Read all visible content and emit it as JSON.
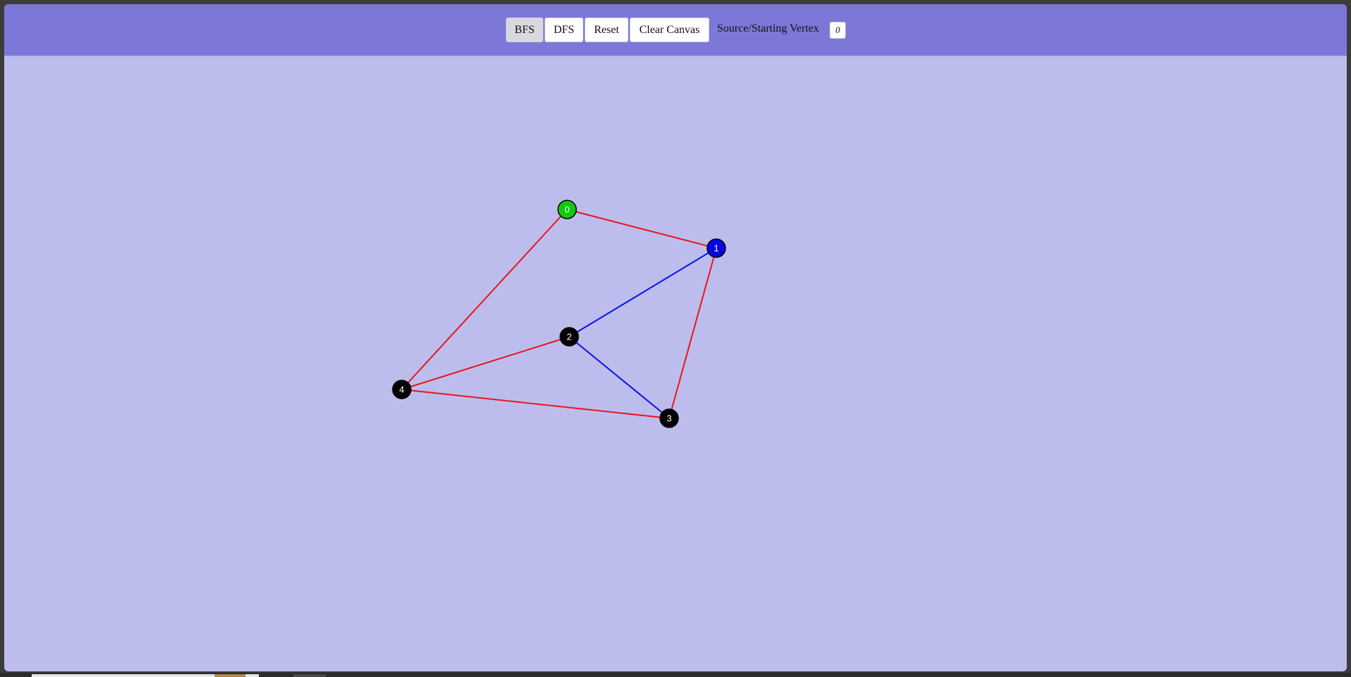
{
  "toolbar": {
    "buttons": [
      {
        "id": "bfs",
        "label": "BFS",
        "active": true
      },
      {
        "id": "dfs",
        "label": "DFS",
        "active": false
      },
      {
        "id": "reset",
        "label": "Reset",
        "active": false
      },
      {
        "id": "clear",
        "label": "Clear Canvas",
        "active": false
      }
    ],
    "source_label": "Source/Starting Vertex",
    "source_value": "0"
  },
  "colors": {
    "toolbar_bg": "#7d78d8",
    "canvas_bg": "#bdbded",
    "edge_default": "#e8141c",
    "edge_highlight": "#0a14e6",
    "node_source": "#0fc90f",
    "node_current": "#0606e0",
    "node_default": "#000000"
  },
  "graph": {
    "nodes": [
      {
        "id": "0",
        "label": "0",
        "state": "source"
      },
      {
        "id": "1",
        "label": "1",
        "state": "current"
      },
      {
        "id": "2",
        "label": "2",
        "state": "default"
      },
      {
        "id": "3",
        "label": "3",
        "state": "default"
      },
      {
        "id": "4",
        "label": "4",
        "state": "default"
      }
    ],
    "edges": [
      {
        "from": "0",
        "to": "1",
        "state": "default"
      },
      {
        "from": "0",
        "to": "4",
        "state": "default"
      },
      {
        "from": "1",
        "to": "2",
        "state": "highlight"
      },
      {
        "from": "1",
        "to": "3",
        "state": "default"
      },
      {
        "from": "2",
        "to": "3",
        "state": "highlight"
      },
      {
        "from": "2",
        "to": "4",
        "state": "default"
      },
      {
        "from": "4",
        "to": "3",
        "state": "default"
      }
    ]
  }
}
